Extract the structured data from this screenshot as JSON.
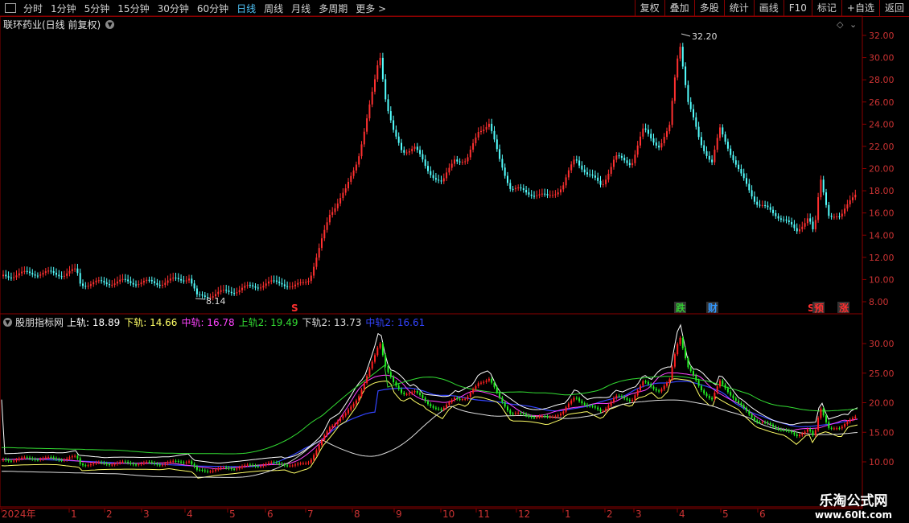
{
  "toolbar": {
    "items": [
      "分时",
      "1分钟",
      "5分钟",
      "15分钟",
      "30分钟",
      "60分钟",
      "日线",
      "周线",
      "月线",
      "多周期",
      "更多 >"
    ],
    "active": "日线",
    "right_items": [
      "复权",
      "叠加",
      "多股",
      "统计",
      "画线",
      "F10",
      "标记",
      "+自选",
      "返回"
    ]
  },
  "title": "联环药业(日线 前复权)",
  "main_chart": {
    "y_ticks": [
      "32.00",
      "30.00",
      "28.00",
      "26.00",
      "24.00",
      "22.00",
      "20.00",
      "18.00",
      "16.00",
      "14.00",
      "12.00",
      "10.00",
      "8.00"
    ],
    "high_label": "32.20",
    "low_label": "8.14",
    "markers": [
      {
        "text": "S",
        "color": "#ff3030"
      },
      {
        "text": "跌",
        "color": "#33cc33"
      },
      {
        "text": "财",
        "color": "#3399ff"
      },
      {
        "text": "S",
        "color": "#ff3030"
      },
      {
        "text": "预",
        "color": "#ff3030"
      },
      {
        "text": "涨",
        "color": "#ff3030"
      }
    ]
  },
  "indicator": {
    "name": "股朋指标网",
    "labels": [
      {
        "text": "上轨:",
        "value": "18.89",
        "color": "#ffffff"
      },
      {
        "text": "下轨:",
        "value": "14.66",
        "color": "#ffff66"
      },
      {
        "text": "中轨:",
        "value": "16.78",
        "color": "#ff44ff"
      },
      {
        "text": "上轨2:",
        "value": "19.49",
        "color": "#33dd33"
      },
      {
        "text": "下轨2:",
        "value": "13.73",
        "color": "#dddddd"
      },
      {
        "text": "中轨2:",
        "value": "16.61",
        "color": "#3344ff"
      }
    ],
    "y_ticks": [
      "30.00",
      "25.00",
      "20.00",
      "15.00",
      "10.00"
    ]
  },
  "x_axis": {
    "labels": [
      "2024年",
      "1",
      "2",
      "3",
      "4",
      "5",
      "6",
      "7",
      "8",
      "9",
      "10",
      "11",
      "12",
      "1",
      "2",
      "3",
      "4",
      "5",
      "6"
    ]
  },
  "watermark": {
    "line1": "乐淘公式网",
    "line2": "www.60lt.com"
  },
  "colors": {
    "up": "#ff3030",
    "down": "#54ffff",
    "frame": "#8b0000",
    "bg": "#000000"
  }
}
